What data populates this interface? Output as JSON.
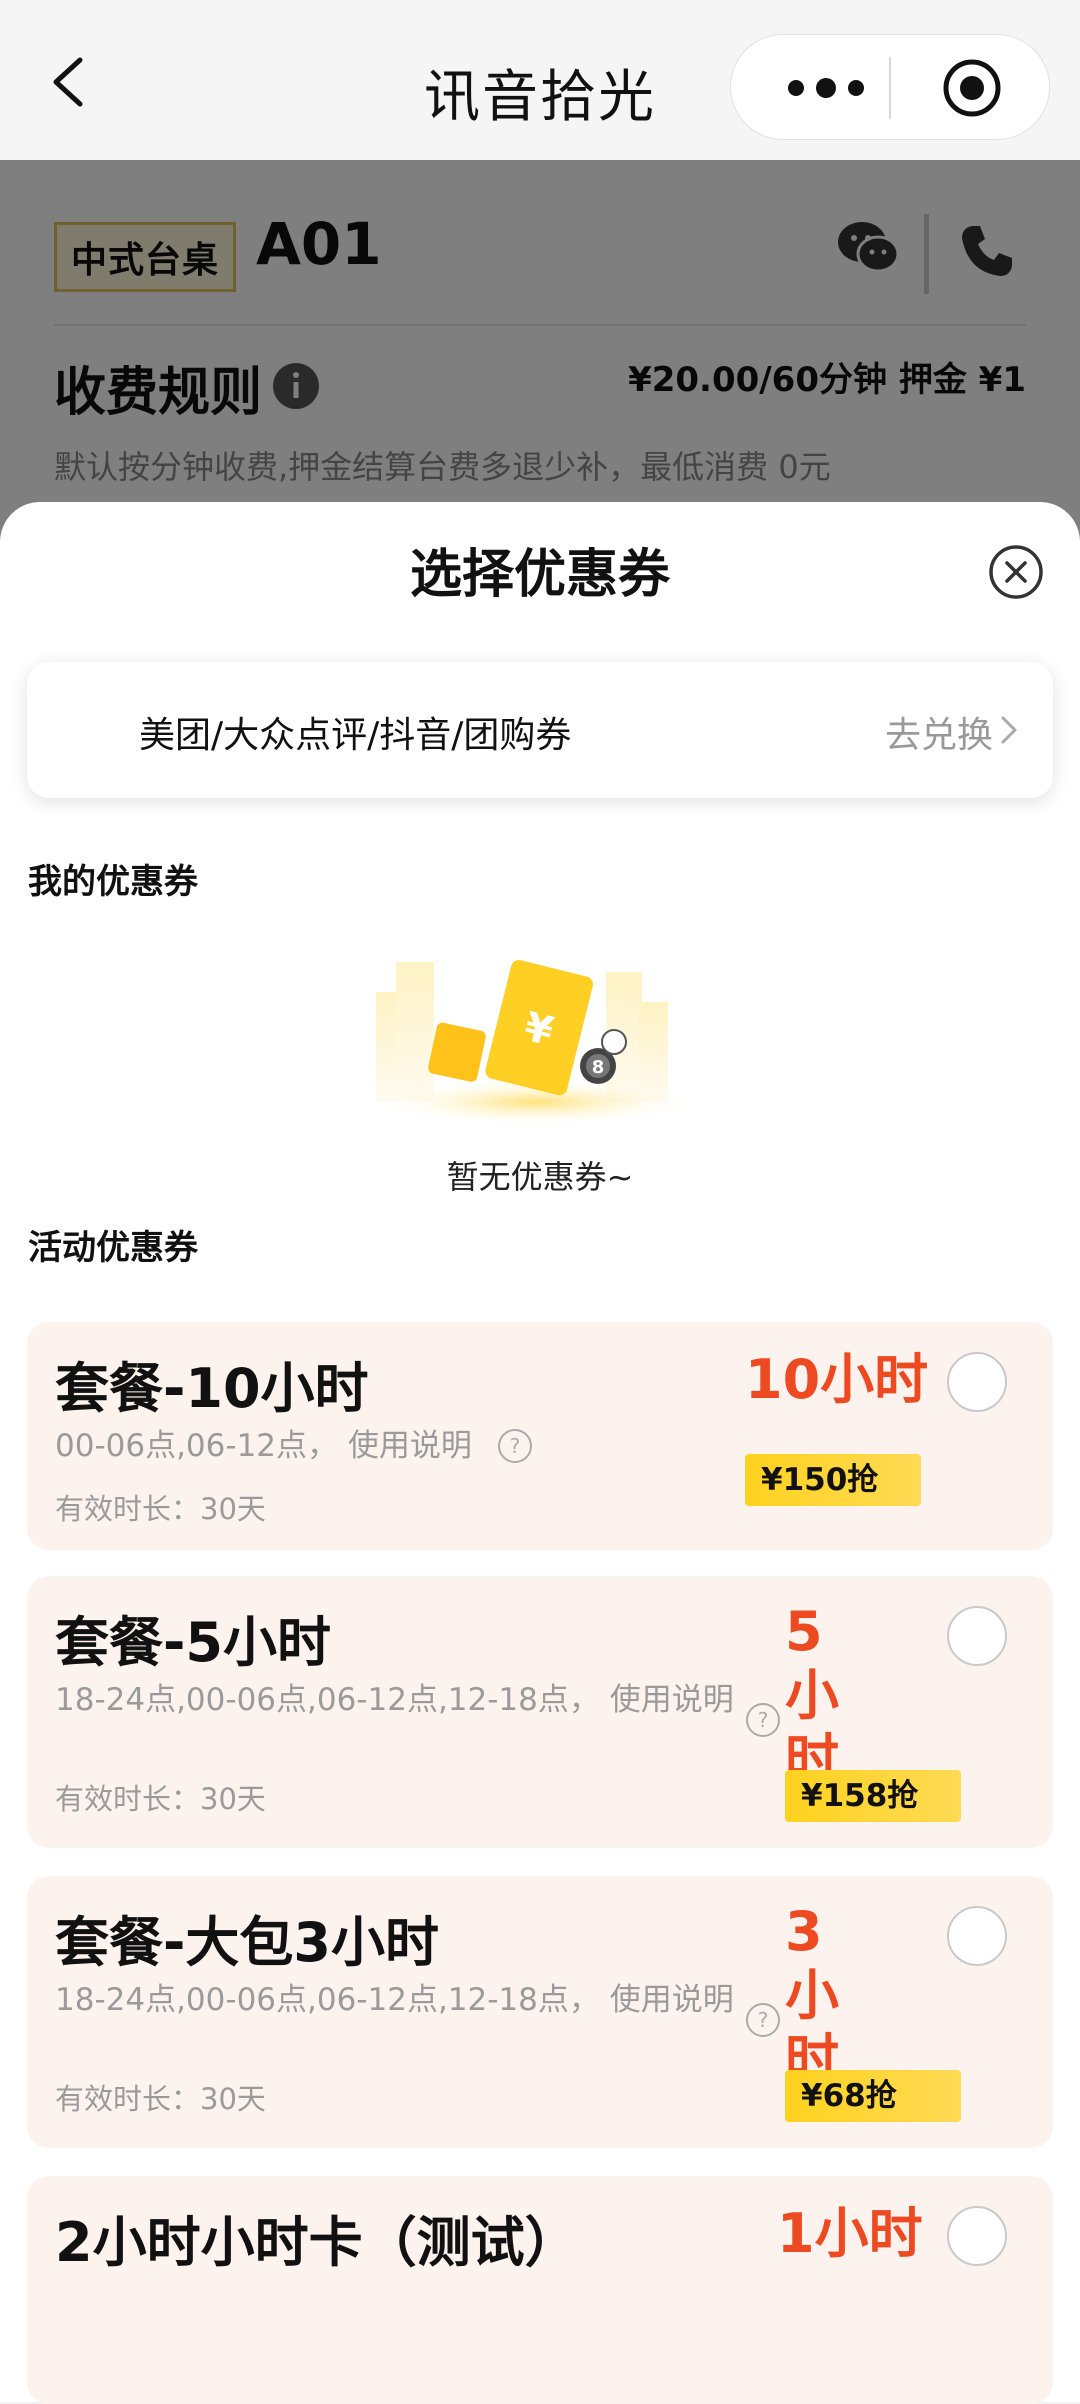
{
  "navbar": {
    "title": "讯音拾光"
  },
  "table": {
    "type_label": "中式台桌",
    "table_id": "A01",
    "rule_title": "收费规则",
    "rule_price": "¥20.00/60分钟 押金 ¥1",
    "rule_desc": "默认按分钟收费,押金结算台费多退少补，最低消费 0元"
  },
  "sheet": {
    "title": "选择优惠券",
    "redeem_label": "美团/大众点评/抖音/团购券",
    "redeem_action": "去兑换",
    "my_coupons_label": "我的优惠券",
    "empty_text": "暂无优惠券~",
    "activity_label": "活动优惠券"
  },
  "coupons": [
    {
      "title": "套餐-10小时",
      "desc": "00-06点,06-12点，  使用说明",
      "valid": "有效时长：30天",
      "hours": "10小时",
      "price": "¥150抢"
    },
    {
      "title": "套餐-5小时",
      "desc": "18-24点,00-06点,06-12点,12-18点，  使用说明",
      "valid": "有效时长：30天",
      "hours": "5小时",
      "price": "¥158抢"
    },
    {
      "title": "套餐-大包3小时",
      "desc": "18-24点,00-06点,06-12点,12-18点，  使用说明",
      "valid": "有效时长：30天",
      "hours": "3小时",
      "price": "¥68抢"
    },
    {
      "title": "2小时小时卡（测试）",
      "hours": "1小时"
    }
  ],
  "colors": {
    "accent_red": "#ee4a22",
    "price_yellow": "#ffd21f",
    "coupon_bg": "#fdf3ee"
  }
}
